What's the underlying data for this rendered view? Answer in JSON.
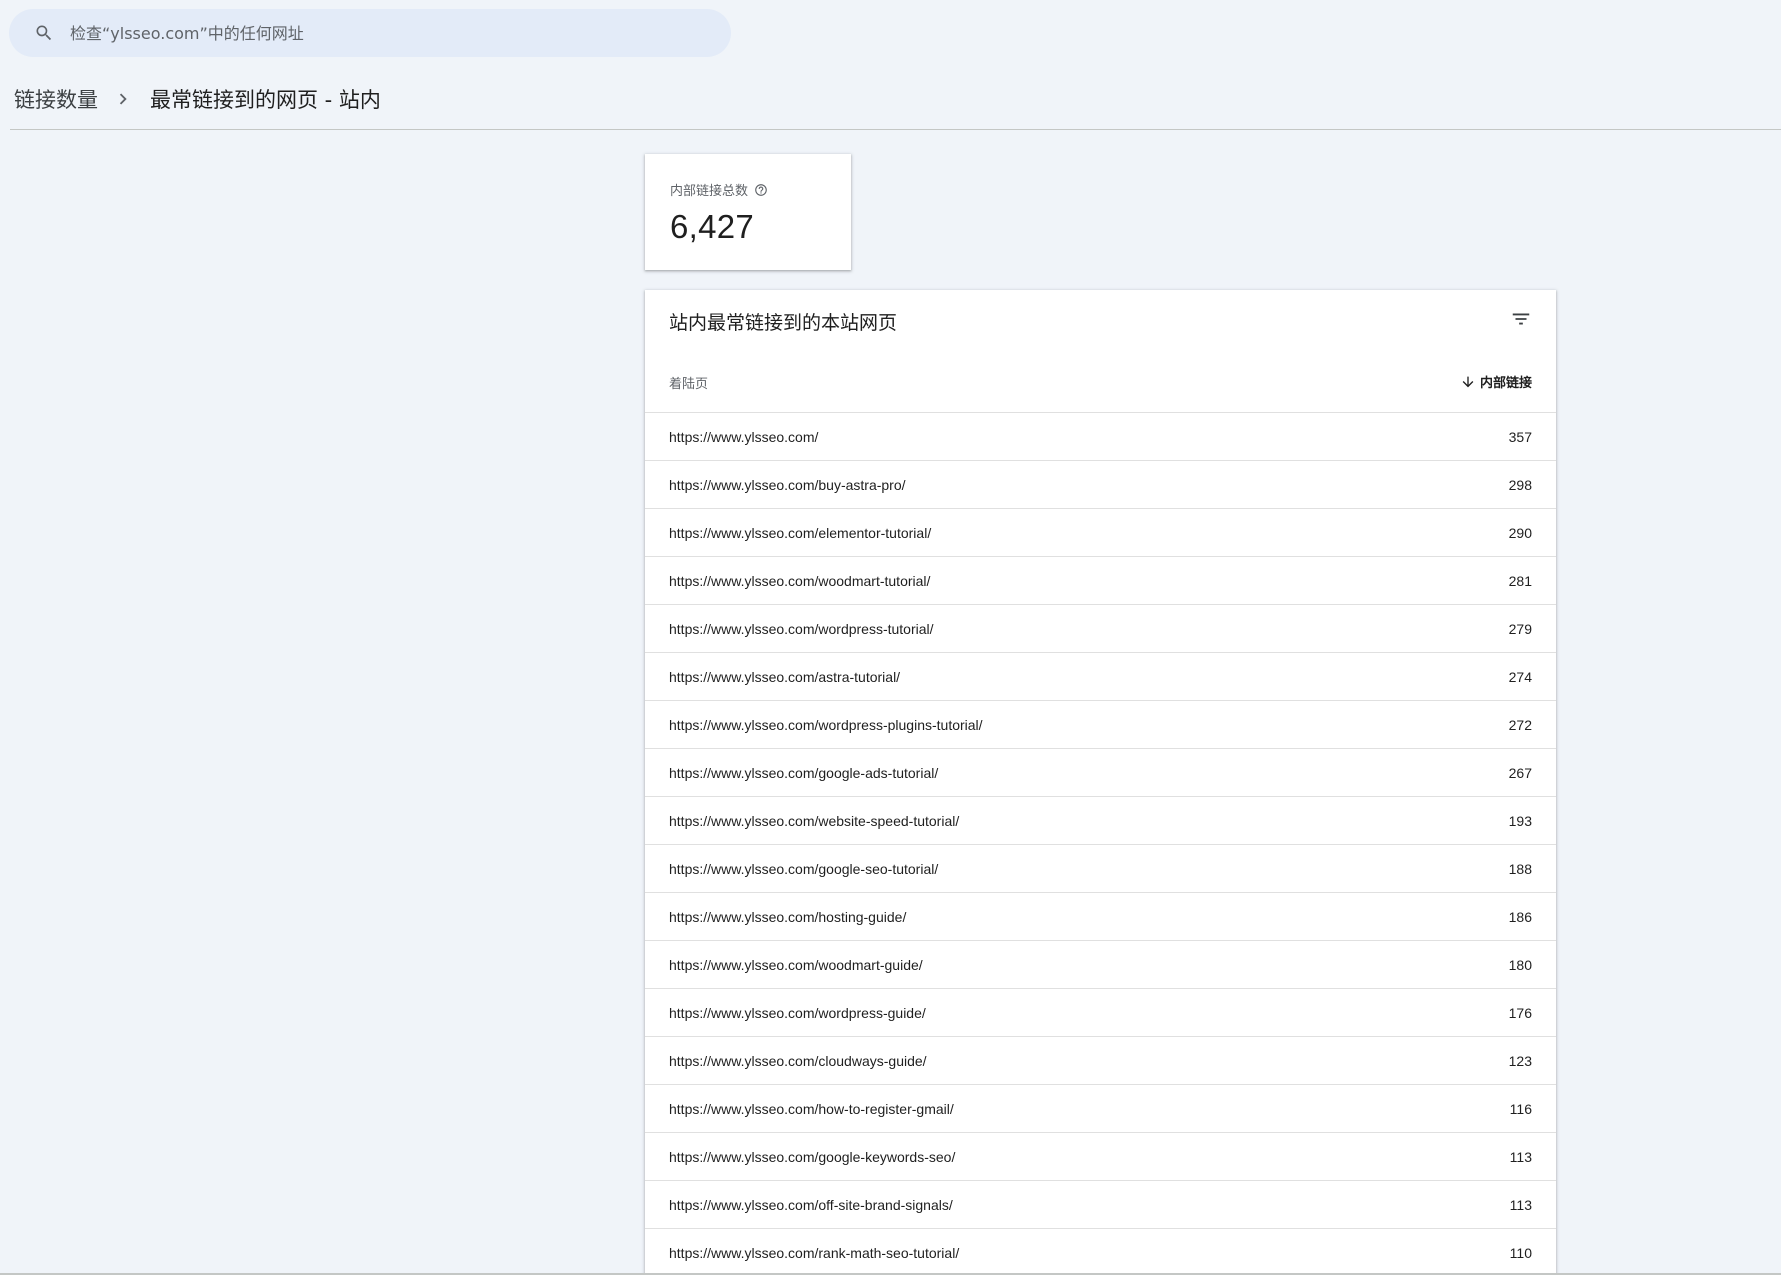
{
  "search": {
    "placeholder": "检查“ylsseo.com”中的任何网址"
  },
  "breadcrumb": {
    "parent": "链接数量",
    "current": "最常链接到的网页 - 站内"
  },
  "total_card": {
    "label": "内部链接总数",
    "value": "6,427"
  },
  "table": {
    "title": "站内最常链接到的本站网页",
    "columns": {
      "landing": "着陆页",
      "links": "内部链接"
    },
    "rows": [
      {
        "url": "https://www.ylsseo.com/",
        "count": "357"
      },
      {
        "url": "https://www.ylsseo.com/buy-astra-pro/",
        "count": "298"
      },
      {
        "url": "https://www.ylsseo.com/elementor-tutorial/",
        "count": "290"
      },
      {
        "url": "https://www.ylsseo.com/woodmart-tutorial/",
        "count": "281"
      },
      {
        "url": "https://www.ylsseo.com/wordpress-tutorial/",
        "count": "279"
      },
      {
        "url": "https://www.ylsseo.com/astra-tutorial/",
        "count": "274"
      },
      {
        "url": "https://www.ylsseo.com/wordpress-plugins-tutorial/",
        "count": "272"
      },
      {
        "url": "https://www.ylsseo.com/google-ads-tutorial/",
        "count": "267"
      },
      {
        "url": "https://www.ylsseo.com/website-speed-tutorial/",
        "count": "193"
      },
      {
        "url": "https://www.ylsseo.com/google-seo-tutorial/",
        "count": "188"
      },
      {
        "url": "https://www.ylsseo.com/hosting-guide/",
        "count": "186"
      },
      {
        "url": "https://www.ylsseo.com/woodmart-guide/",
        "count": "180"
      },
      {
        "url": "https://www.ylsseo.com/wordpress-guide/",
        "count": "176"
      },
      {
        "url": "https://www.ylsseo.com/cloudways-guide/",
        "count": "123"
      },
      {
        "url": "https://www.ylsseo.com/how-to-register-gmail/",
        "count": "116"
      },
      {
        "url": "https://www.ylsseo.com/google-keywords-seo/",
        "count": "113"
      },
      {
        "url": "https://www.ylsseo.com/off-site-brand-signals/",
        "count": "113"
      },
      {
        "url": "https://www.ylsseo.com/rank-math-seo-tutorial/",
        "count": "110"
      }
    ]
  },
  "icons": {
    "search": "search-icon",
    "breadcrumb_separator": "chevron-right-icon",
    "help": "help-circle-icon",
    "filter": "filter-icon",
    "sort": "arrow-down-icon"
  },
  "colors": {
    "background": "#f0f4f9",
    "search_bg": "#e3ebf8",
    "card_bg": "#ffffff",
    "text_primary": "#1f1f1f",
    "text_secondary": "#5f6368",
    "divider": "#e0e0e0"
  }
}
